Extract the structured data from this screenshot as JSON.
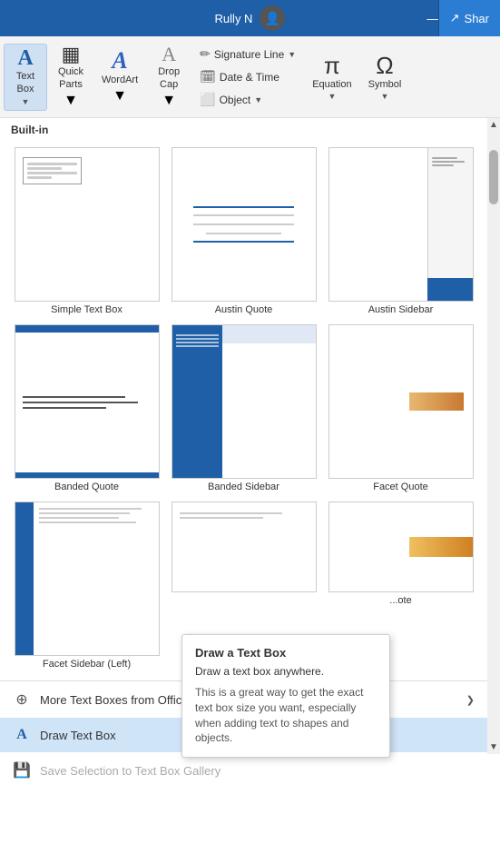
{
  "titleBar": {
    "userName": "Rully N",
    "shareLabel": "Shar",
    "minimize": "—",
    "restore": "❐"
  },
  "ribbon": {
    "textBox": {
      "label": "Text\nBox",
      "icon": "A"
    },
    "quickParts": {
      "label": "Quick\nParts",
      "icon": "▦"
    },
    "wordArt": {
      "label": "WordArt",
      "icon": "A"
    },
    "dropCap": {
      "label": "Drop\nCap",
      "icon": "A"
    },
    "signatureLine": {
      "label": "Signature Line",
      "arrow": "▼"
    },
    "dateTime": {
      "label": "Date & Time"
    },
    "object": {
      "label": "Object",
      "arrow": "▼"
    },
    "equation": {
      "label": "Equation",
      "arrow": "▼"
    },
    "symbol": {
      "label": "Symbol",
      "arrow": "▼"
    }
  },
  "dropdown": {
    "sectionLabel": "Built-in",
    "items": [
      {
        "label": "Simple Text Box",
        "type": "simple"
      },
      {
        "label": "Austin Quote",
        "type": "austin-quote"
      },
      {
        "label": "Austin Sidebar",
        "type": "austin-sidebar"
      },
      {
        "label": "Banded Quote",
        "type": "banded-quote"
      },
      {
        "label": "Banded Sidebar",
        "type": "banded-sidebar"
      },
      {
        "label": "Facet Quote",
        "type": "facet-quote"
      },
      {
        "label": "Facet Sidebar (Left)",
        "type": "facet-sidebar-left"
      },
      {
        "label": "...",
        "type": "facet-sidebar-right"
      },
      {
        "label": "...ote",
        "type": "facet-quote2"
      }
    ],
    "menuItems": [
      {
        "label": "More Text Boxes from Office.com",
        "icon": "⊕",
        "arrow": "❯",
        "id": "more-textboxes",
        "disabled": false
      },
      {
        "label": "Draw Text Box",
        "icon": "A",
        "id": "draw-textbox",
        "highlighted": true,
        "disabled": false
      },
      {
        "label": "Save Selection to Text Box Gallery",
        "icon": "💾",
        "id": "save-selection",
        "disabled": true
      }
    ]
  },
  "tooltip": {
    "title": "Draw a Text Box",
    "subtitle": "Draw a text box anywhere.",
    "description": "This is a great way to get the exact text box size you want, especially when adding text to shapes and objects."
  }
}
